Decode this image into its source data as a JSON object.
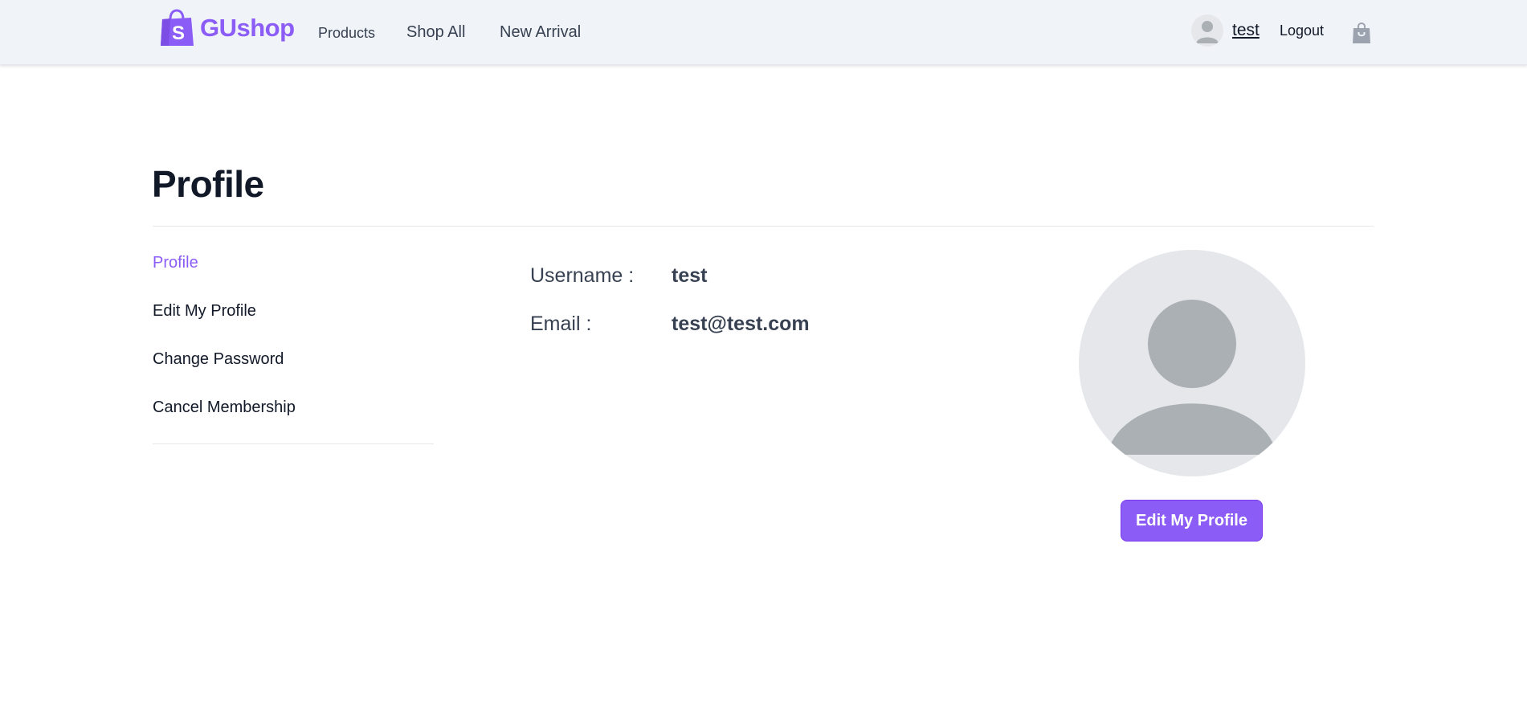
{
  "header": {
    "brand": "GUshop",
    "brand_color": "#8b5cf6",
    "nav": [
      {
        "label": "Products"
      },
      {
        "label": "Shop All"
      },
      {
        "label": "New Arrival"
      }
    ],
    "user": {
      "name": "test",
      "avatar_icon": "user-avatar-icon"
    },
    "logout_label": "Logout",
    "cart_icon": "shopping-bag-icon"
  },
  "page": {
    "title": "Profile"
  },
  "sidebar": {
    "items": [
      {
        "label": "Profile",
        "active": true
      },
      {
        "label": "Edit My Profile",
        "active": false
      },
      {
        "label": "Change Password",
        "active": false
      },
      {
        "label": "Cancel Membership",
        "active": false
      }
    ]
  },
  "profile": {
    "fields": [
      {
        "label": "Username :",
        "value": "test"
      },
      {
        "label": "Email :",
        "value": "test@test.com"
      }
    ],
    "avatar_icon": "user-avatar-icon",
    "edit_button_label": "Edit My Profile"
  },
  "colors": {
    "accent": "#8b5cf6",
    "header_bg": "#f0f3f8",
    "avatar_bg": "#e5e7eb",
    "avatar_fg": "#abb0b4"
  }
}
